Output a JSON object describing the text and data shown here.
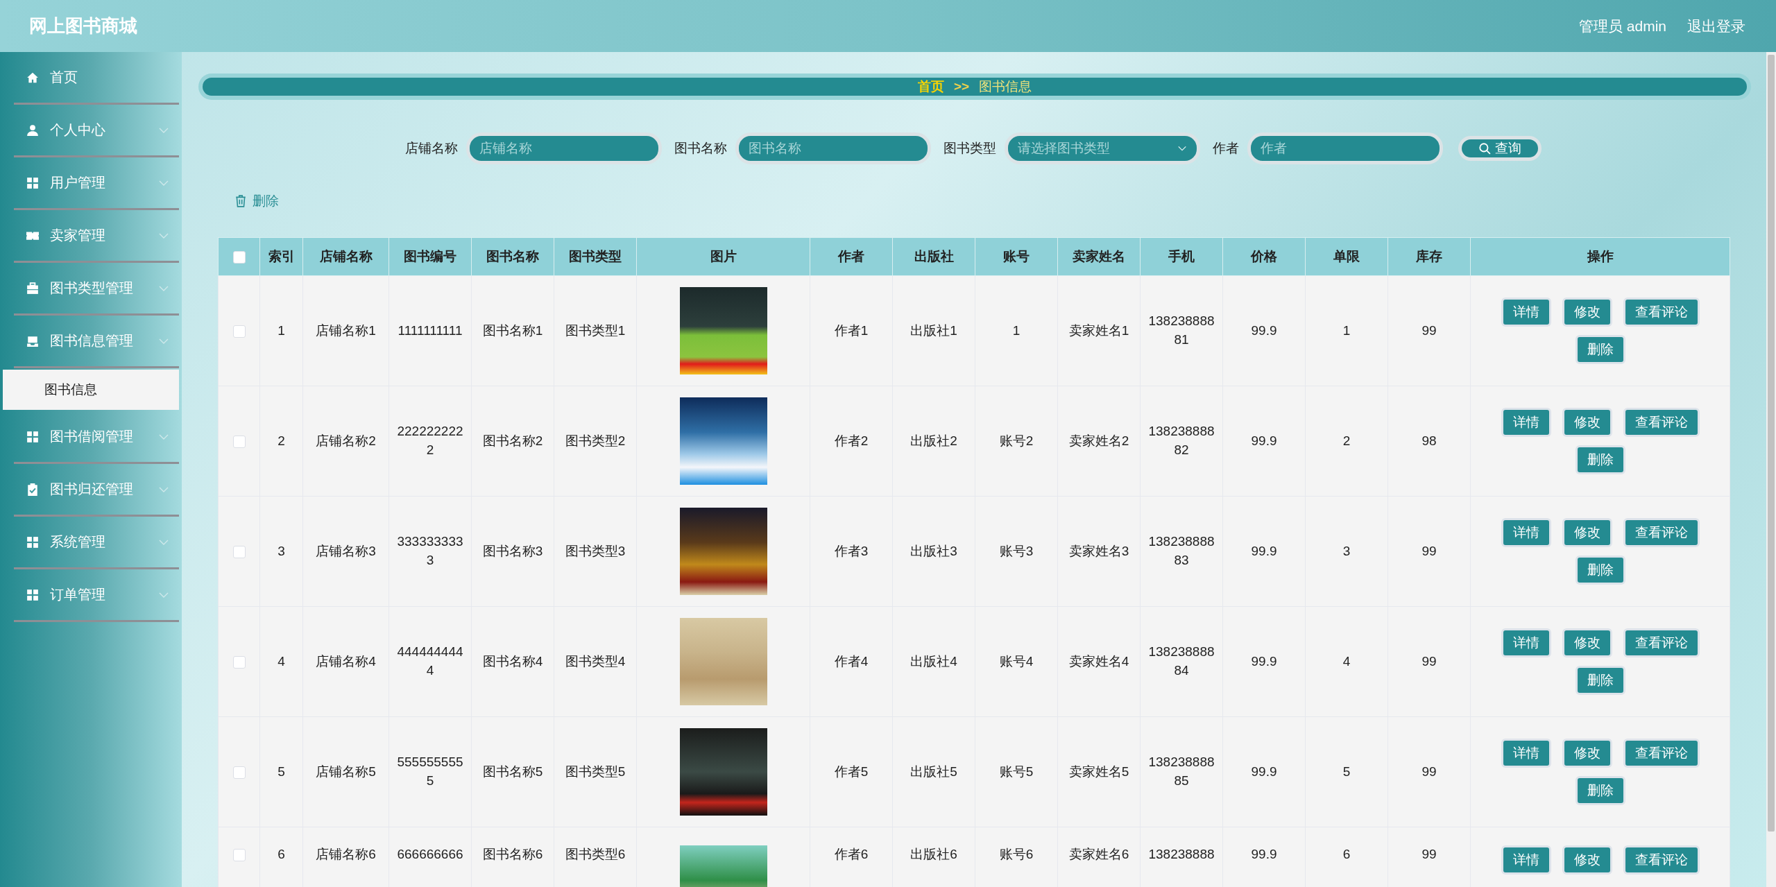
{
  "header": {
    "title": "网上图书商城",
    "user": "管理员 admin",
    "logout": "退出登录"
  },
  "sidebar": {
    "items": [
      {
        "label": "首页",
        "kind": "link"
      },
      {
        "label": "个人中心",
        "kind": "menu"
      },
      {
        "label": "用户管理",
        "kind": "menu"
      },
      {
        "label": "卖家管理",
        "kind": "menu"
      },
      {
        "label": "图书类型管理",
        "kind": "menu"
      },
      {
        "label": "图书信息管理",
        "kind": "menu",
        "children": [
          {
            "label": "图书信息",
            "selected": true
          }
        ]
      },
      {
        "label": "图书借阅管理",
        "kind": "menu"
      },
      {
        "label": "图书归还管理",
        "kind": "menu"
      },
      {
        "label": "系统管理",
        "kind": "menu"
      },
      {
        "label": "订单管理",
        "kind": "menu"
      }
    ]
  },
  "breadcrumb": {
    "items": [
      "首页",
      "图书信息"
    ],
    "separator": ">>"
  },
  "search": {
    "fields": [
      {
        "label": "店铺名称",
        "placeholder": "店铺名称",
        "kind": "input"
      },
      {
        "label": "图书名称",
        "placeholder": "图书名称",
        "kind": "input"
      },
      {
        "label": "图书类型",
        "placeholder": "请选择图书类型",
        "kind": "select"
      },
      {
        "label": "作者",
        "placeholder": "作者",
        "kind": "input"
      }
    ],
    "button": "查询"
  },
  "toolbar": {
    "delete": "删除"
  },
  "table": {
    "select_all": {
      "checked": false
    },
    "columns": [
      {
        "label": "索引",
        "kind": "text"
      },
      {
        "label": "店铺名称",
        "kind": "text"
      },
      {
        "label": "图书编号",
        "kind": "text"
      },
      {
        "label": "图书名称",
        "kind": "text"
      },
      {
        "label": "图书类型",
        "kind": "text"
      },
      {
        "label": "图片",
        "kind": "image"
      },
      {
        "label": "作者",
        "kind": "text"
      },
      {
        "label": "出版社",
        "kind": "text"
      },
      {
        "label": "账号",
        "kind": "text"
      },
      {
        "label": "卖家姓名",
        "kind": "text"
      },
      {
        "label": "手机",
        "kind": "text"
      },
      {
        "label": "价格",
        "kind": "text"
      },
      {
        "label": "单限",
        "kind": "text"
      },
      {
        "label": "库存",
        "kind": "text"
      },
      {
        "label": "操作",
        "kind": "actions"
      }
    ],
    "rows": [
      {
        "checked": false,
        "cells": [
          "1",
          "店铺名称1",
          "1111111111",
          "图书名称1",
          "图书类型1",
          "",
          "作者1",
          "出版社1",
          "1",
          "卖家姓名1",
          "13823888881",
          "99.9",
          "1",
          "99"
        ],
        "actions": [
          "详情",
          "修改",
          "查看评论",
          "删除"
        ]
      },
      {
        "checked": false,
        "cells": [
          "2",
          "店铺名称2",
          "2222222222",
          "图书名称2",
          "图书类型2",
          "",
          "作者2",
          "出版社2",
          "账号2",
          "卖家姓名2",
          "13823888882",
          "99.9",
          "2",
          "98"
        ],
        "actions": [
          "详情",
          "修改",
          "查看评论",
          "删除"
        ]
      },
      {
        "checked": false,
        "cells": [
          "3",
          "店铺名称3",
          "3333333333",
          "图书名称3",
          "图书类型3",
          "",
          "作者3",
          "出版社3",
          "账号3",
          "卖家姓名3",
          "13823888883",
          "99.9",
          "3",
          "99"
        ],
        "actions": [
          "详情",
          "修改",
          "查看评论",
          "删除"
        ]
      },
      {
        "checked": false,
        "cells": [
          "4",
          "店铺名称4",
          "4444444444",
          "图书名称4",
          "图书类型4",
          "",
          "作者4",
          "出版社4",
          "账号4",
          "卖家姓名4",
          "13823888884",
          "99.9",
          "4",
          "99"
        ],
        "actions": [
          "详情",
          "修改",
          "查看评论",
          "删除"
        ]
      },
      {
        "checked": false,
        "cells": [
          "5",
          "店铺名称5",
          "5555555555",
          "图书名称5",
          "图书类型5",
          "",
          "作者5",
          "出版社5",
          "账号5",
          "卖家姓名5",
          "13823888885",
          "99.9",
          "5",
          "99"
        ],
        "actions": [
          "详情",
          "修改",
          "查看评论",
          "删除"
        ]
      },
      {
        "checked": false,
        "cells": [
          "6",
          "店铺名称6",
          "666666666",
          "图书名称6",
          "图书类型6",
          "",
          "作者6",
          "出版社6",
          "账号6",
          "卖家姓名6",
          "138238888",
          "99.9",
          "6",
          "99"
        ],
        "actions": [
          "详情",
          "修改",
          "查看评论"
        ]
      }
    ]
  }
}
